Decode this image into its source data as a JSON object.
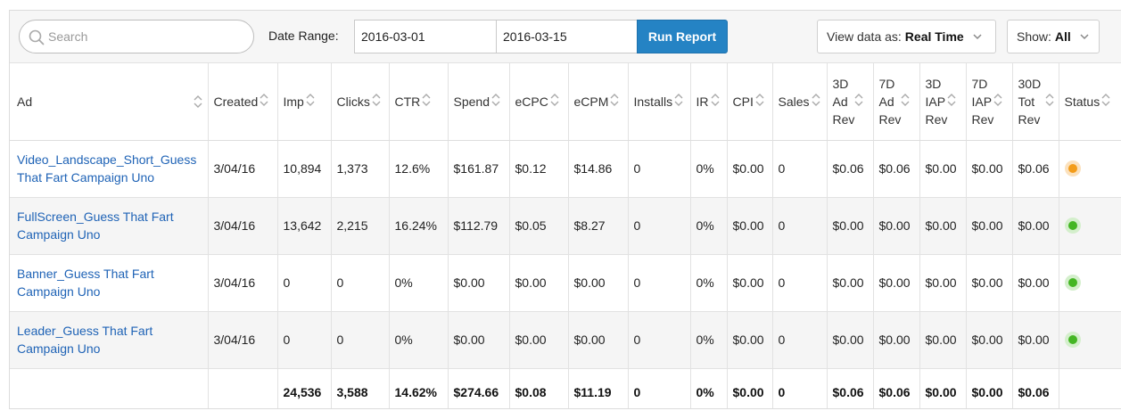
{
  "toolbar": {
    "search_placeholder": "Search",
    "date_range_label": "Date Range:",
    "start_date": "2016-03-01",
    "end_date": "2016-03-15",
    "run_report_label": "Run Report",
    "view_data_label": "View data as:",
    "view_data_value": "Real Time",
    "show_label": "Show:",
    "show_value": "All"
  },
  "table": {
    "headers": {
      "ad": "Ad",
      "created": "Created",
      "imp": "Imp",
      "clicks": "Clicks",
      "ctr": "CTR",
      "spend": "Spend",
      "ecpc": "eCPC",
      "ecpm": "eCPM",
      "installs": "Installs",
      "ir": "IR",
      "cpi": "CPI",
      "sales": "Sales",
      "ad3": "3D Ad Rev",
      "ad7": "7D Ad Rev",
      "iap3": "3D IAP Rev",
      "iap7": "7D IAP Rev",
      "tot30": "30D Tot Rev",
      "status": "Status"
    },
    "rows": [
      {
        "ad": "Video_Landscape_Short_Guess That Fart Campaign Uno",
        "created": "3/04/16",
        "imp": "10,894",
        "clicks": "1,373",
        "ctr": "12.6%",
        "spend": "$161.87",
        "ecpc": "$0.12",
        "ecpm": "$14.86",
        "installs": "0",
        "ir": "0%",
        "cpi": "$0.00",
        "sales": "0",
        "ad3": "$0.06",
        "ad7": "$0.06",
        "iap3": "$0.00",
        "iap7": "$0.00",
        "tot30": "$0.06",
        "status": "orange"
      },
      {
        "ad": "FullScreen_Guess That Fart Campaign Uno",
        "created": "3/04/16",
        "imp": "13,642",
        "clicks": "2,215",
        "ctr": "16.24%",
        "spend": "$112.79",
        "ecpc": "$0.05",
        "ecpm": "$8.27",
        "installs": "0",
        "ir": "0%",
        "cpi": "$0.00",
        "sales": "0",
        "ad3": "$0.00",
        "ad7": "$0.00",
        "iap3": "$0.00",
        "iap7": "$0.00",
        "tot30": "$0.00",
        "status": "green"
      },
      {
        "ad": "Banner_Guess That Fart Campaign Uno",
        "created": "3/04/16",
        "imp": "0",
        "clicks": "0",
        "ctr": "0%",
        "spend": "$0.00",
        "ecpc": "$0.00",
        "ecpm": "$0.00",
        "installs": "0",
        "ir": "0%",
        "cpi": "$0.00",
        "sales": "0",
        "ad3": "$0.00",
        "ad7": "$0.00",
        "iap3": "$0.00",
        "iap7": "$0.00",
        "tot30": "$0.00",
        "status": "green"
      },
      {
        "ad": "Leader_Guess That Fart Campaign Uno",
        "created": "3/04/16",
        "imp": "0",
        "clicks": "0",
        "ctr": "0%",
        "spend": "$0.00",
        "ecpc": "$0.00",
        "ecpm": "$0.00",
        "installs": "0",
        "ir": "0%",
        "cpi": "$0.00",
        "sales": "0",
        "ad3": "$0.00",
        "ad7": "$0.00",
        "iap3": "$0.00",
        "iap7": "$0.00",
        "tot30": "$0.00",
        "status": "green"
      }
    ],
    "totals": {
      "imp": "24,536",
      "clicks": "3,588",
      "ctr": "14.62%",
      "spend": "$274.66",
      "ecpc": "$0.08",
      "ecpm": "$11.19",
      "installs": "0",
      "ir": "0%",
      "cpi": "$0.00",
      "sales": "0",
      "ad3": "$0.06",
      "ad7": "$0.06",
      "iap3": "$0.00",
      "iap7": "$0.00",
      "tot30": "$0.06"
    }
  },
  "icons": {
    "search": "search-icon",
    "sort": "sort-arrows-icon",
    "chevron": "chevron-down-icon",
    "status": "status-dot-icon"
  },
  "colors": {
    "accent": "#2583c4",
    "link": "#1f63b6",
    "status_orange": "#f39c1a",
    "status_green": "#44b623"
  }
}
